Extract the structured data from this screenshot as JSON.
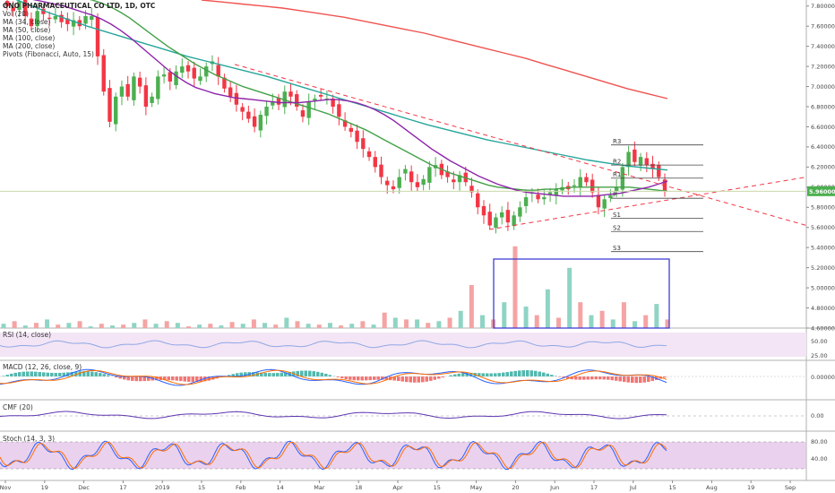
{
  "header": {
    "title": "ONO PHARMACEUTICAL CO LTD, 1D, OTC",
    "main_legend": [
      "Vol (20)",
      "MA (34, close)",
      "MA (50, close)",
      "MA (100, close)",
      "MA (200, close)",
      "Pivots (Fibonacci, Auto, 15)"
    ]
  },
  "panes": {
    "rsi": {
      "title": "RSI (14, close)",
      "ticks": [
        "50.00",
        "25.00"
      ]
    },
    "macd": {
      "title": "MACD (12, 26, close, 9)",
      "ticks": [
        "0.000000"
      ]
    },
    "cmf": {
      "title": "CMF (20)",
      "ticks": [
        "0.00"
      ]
    },
    "stoch": {
      "title": "Stoch (14, 3, 3)",
      "ticks": [
        "80.00",
        "40.00"
      ]
    }
  },
  "price_badge": {
    "value": "5.960000",
    "color": "#4caf50"
  },
  "pivot_labels": [
    "R3",
    "R2",
    "R1",
    "P",
    "S1",
    "S2",
    "S3"
  ],
  "colors": {
    "up": "#4caf50",
    "down": "#f23645",
    "vol_up": "#8fd4c4",
    "vol_down": "#f5a3a3",
    "ma34": "#8e24aa",
    "ma50": "#43a047",
    "ma100": "#26a69a",
    "ma200": "#ef5350",
    "trend": "#f23645",
    "stoch_band": "#e1bee7",
    "box": "#3f3fd6"
  },
  "chart_data": {
    "type": "candlestick",
    "x_ticks": [
      "Nov",
      "19",
      "Dec",
      "17",
      "2019",
      "15",
      "Feb",
      "14",
      "Mar",
      "18",
      "Apr",
      "15",
      "May",
      "20",
      "Jun",
      "17",
      "Jul",
      "15",
      "Aug",
      "19",
      "Sep"
    ],
    "y_ticks": [
      "7.800000",
      "7.600000",
      "7.400000",
      "7.200000",
      "7.000000",
      "6.800000",
      "6.600000",
      "6.400000",
      "6.200000",
      "6.000000",
      "5.800000",
      "5.600000",
      "5.400000",
      "5.200000",
      "5.000000",
      "4.800000",
      "4.600000"
    ],
    "ylim": [
      4.6,
      7.86
    ],
    "last_price": 5.96,
    "close_series": [
      7.8,
      7.75,
      7.85,
      7.7,
      7.6,
      7.75,
      7.72,
      7.68,
      7.7,
      7.64,
      7.62,
      7.66,
      7.6,
      7.7,
      7.7,
      7.3,
      6.95,
      6.65,
      6.9,
      7.0,
      6.9,
      7.1,
      7.0,
      6.8,
      6.9,
      7.1,
      7.12,
      7.05,
      7.15,
      7.2,
      7.15,
      7.08,
      7.1,
      7.2,
      7.25,
      7.1,
      6.98,
      6.9,
      6.82,
      6.75,
      6.68,
      6.6,
      6.72,
      6.8,
      6.85,
      6.82,
      6.95,
      6.9,
      6.8,
      6.7,
      6.85,
      6.88,
      6.9,
      6.88,
      6.8,
      6.7,
      6.6,
      6.55,
      6.45,
      6.38,
      6.3,
      6.2,
      6.1,
      6.02,
      5.98,
      6.1,
      6.18,
      6.05,
      6.0,
      6.08,
      6.2,
      6.22,
      6.12,
      6.1,
      6.05,
      6.12,
      6.05,
      5.95,
      5.8,
      5.72,
      5.62,
      5.7,
      5.75,
      5.65,
      5.72,
      5.8,
      5.9,
      5.95,
      5.88,
      5.9,
      5.95,
      5.98,
      6.0,
      5.98,
      6.02,
      6.1,
      6.05,
      5.95,
      5.8,
      5.88,
      5.92,
      6.0,
      6.2,
      6.35,
      6.25,
      6.3,
      6.22,
      6.18,
      6.1,
      5.96
    ],
    "ma34": [
      7.9,
      7.89,
      7.88,
      7.86,
      7.84,
      7.82,
      7.8,
      7.77,
      7.74,
      7.71,
      7.67,
      7.62,
      7.56,
      7.49,
      7.41,
      7.33,
      7.25,
      7.17,
      7.1,
      7.04,
      6.99,
      6.96,
      6.93,
      6.91,
      6.89,
      6.88,
      6.87,
      6.86,
      6.85,
      6.84,
      6.84,
      6.84,
      6.85,
      6.86,
      6.87,
      6.87,
      6.86,
      6.84,
      6.81,
      6.77,
      6.72,
      6.66,
      6.59,
      6.52,
      6.45,
      6.38,
      6.32,
      6.26,
      6.21,
      6.16,
      6.11,
      6.07,
      6.03,
      6.0,
      5.97,
      5.95,
      5.94,
      5.93,
      5.92,
      5.91,
      5.91,
      5.91,
      5.91,
      5.92,
      5.93,
      5.94,
      5.96,
      5.98,
      6.0,
      6.03,
      6.06
    ],
    "ma50": [
      7.95,
      7.95,
      7.95,
      7.94,
      7.94,
      7.93,
      7.92,
      7.9,
      7.88,
      7.86,
      7.83,
      7.79,
      7.74,
      7.68,
      7.61,
      7.54,
      7.47,
      7.4,
      7.34,
      7.28,
      7.22,
      7.17,
      7.12,
      7.08,
      7.04,
      7.0,
      6.97,
      6.94,
      6.91,
      6.88,
      6.85,
      6.82,
      6.79,
      6.76,
      6.73,
      6.69,
      6.65,
      6.61,
      6.57,
      6.52,
      6.47,
      6.42,
      6.37,
      6.32,
      6.27,
      6.22,
      6.18,
      6.14,
      6.11,
      6.08,
      6.05,
      6.02,
      6.0,
      5.99,
      5.98,
      5.97,
      5.97,
      5.98,
      5.98,
      5.99,
      6.0,
      6.0,
      6.0,
      6.0,
      6.0,
      6.0,
      6.0,
      5.99,
      5.98,
      5.97,
      5.96
    ],
    "ma100": [
      7.9,
      7.82,
      7.74,
      7.67,
      7.6,
      7.54,
      7.48,
      7.42,
      7.36,
      7.3,
      7.25,
      7.2,
      7.15,
      7.1,
      7.04,
      6.98,
      6.92,
      6.86,
      6.8,
      6.74,
      6.68,
      6.62,
      6.57,
      6.52,
      6.47,
      6.43,
      6.39,
      6.35,
      6.31,
      6.27,
      6.24,
      6.21,
      6.19,
      6.17
    ],
    "ma200": [
      7.86,
      7.84,
      7.82,
      7.8,
      7.78,
      7.75,
      7.72,
      7.69,
      7.65,
      7.61,
      7.57,
      7.53,
      7.48,
      7.43,
      7.38,
      7.33,
      7.28,
      7.22,
      7.16,
      7.1,
      7.04,
      6.98,
      6.93,
      6.88
    ],
    "pivots": {
      "R3": 6.42,
      "R2": 6.22,
      "R1": 6.09,
      "P": 5.89,
      "S1": 5.69,
      "S2": 5.56,
      "S3": 5.36
    },
    "volume": [
      0.05,
      0.08,
      0.03,
      0.06,
      0.1,
      0.04,
      0.06,
      0.08,
      0.02,
      0.05,
      0.03,
      0.04,
      0.06,
      0.1,
      0.05,
      0.08,
      0.06,
      0.02,
      0.04,
      0.05,
      0.03,
      0.07,
      0.05,
      0.1,
      0.06,
      0.04,
      0.12,
      0.08,
      0.05,
      0.04,
      0.06,
      0.03,
      0.05,
      0.08,
      0.04,
      0.18,
      0.12,
      0.1,
      0.1,
      0.06,
      0.08,
      0.12,
      0.2,
      0.5,
      0.15,
      0.1,
      0.3,
      0.95,
      0.25,
      0.15,
      0.45,
      0.12,
      0.7,
      0.3,
      0.15,
      0.2,
      0.1,
      0.3,
      0.08,
      0.15,
      0.28,
      0.1
    ]
  }
}
